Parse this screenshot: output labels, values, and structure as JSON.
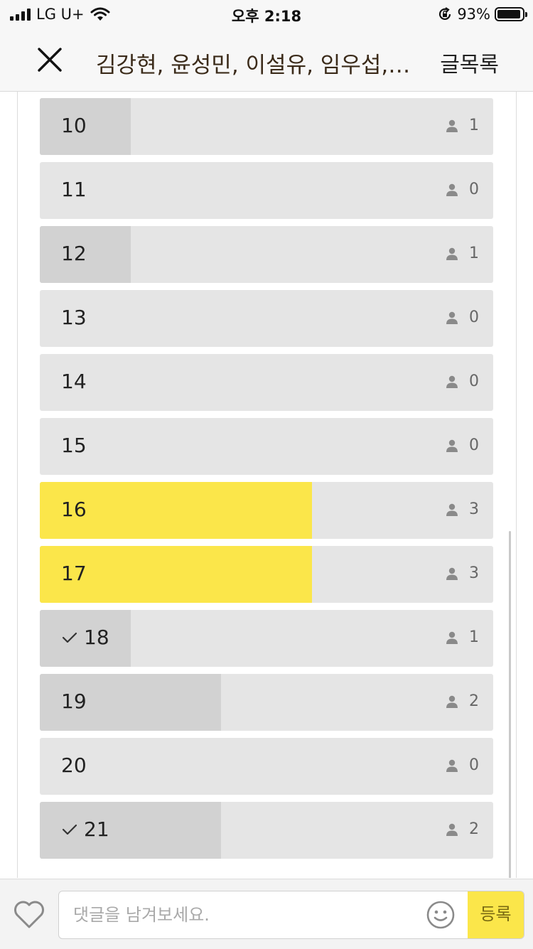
{
  "status_bar": {
    "carrier": "LG U+",
    "time": "오후 2:18",
    "battery": "93%",
    "battery_level": 0.93
  },
  "header": {
    "title": "김강현, 윤성민, 이설유, 임우섭, 안세훈",
    "action_label": "글목록"
  },
  "colors": {
    "accent": "#fbe64a",
    "bar_gray": "#d2d2d2",
    "track": "#e5e5e5"
  },
  "poll": {
    "max_votes": 5,
    "options": [
      {
        "label": "10",
        "votes": "1",
        "checked": false,
        "leading": false
      },
      {
        "label": "11",
        "votes": "0",
        "checked": false,
        "leading": false
      },
      {
        "label": "12",
        "votes": "1",
        "checked": false,
        "leading": false
      },
      {
        "label": "13",
        "votes": "0",
        "checked": false,
        "leading": false
      },
      {
        "label": "14",
        "votes": "0",
        "checked": false,
        "leading": false
      },
      {
        "label": "15",
        "votes": "0",
        "checked": false,
        "leading": false
      },
      {
        "label": "16",
        "votes": "3",
        "checked": false,
        "leading": true
      },
      {
        "label": "17",
        "votes": "3",
        "checked": false,
        "leading": true
      },
      {
        "label": "18",
        "votes": "1",
        "checked": true,
        "leading": false
      },
      {
        "label": "19",
        "votes": "2",
        "checked": false,
        "leading": false
      },
      {
        "label": "20",
        "votes": "0",
        "checked": false,
        "leading": false
      },
      {
        "label": "21",
        "votes": "2",
        "checked": true,
        "leading": false
      }
    ]
  },
  "comment": {
    "placeholder": "댓글을 남겨보세요.",
    "submit_label": "등록"
  }
}
